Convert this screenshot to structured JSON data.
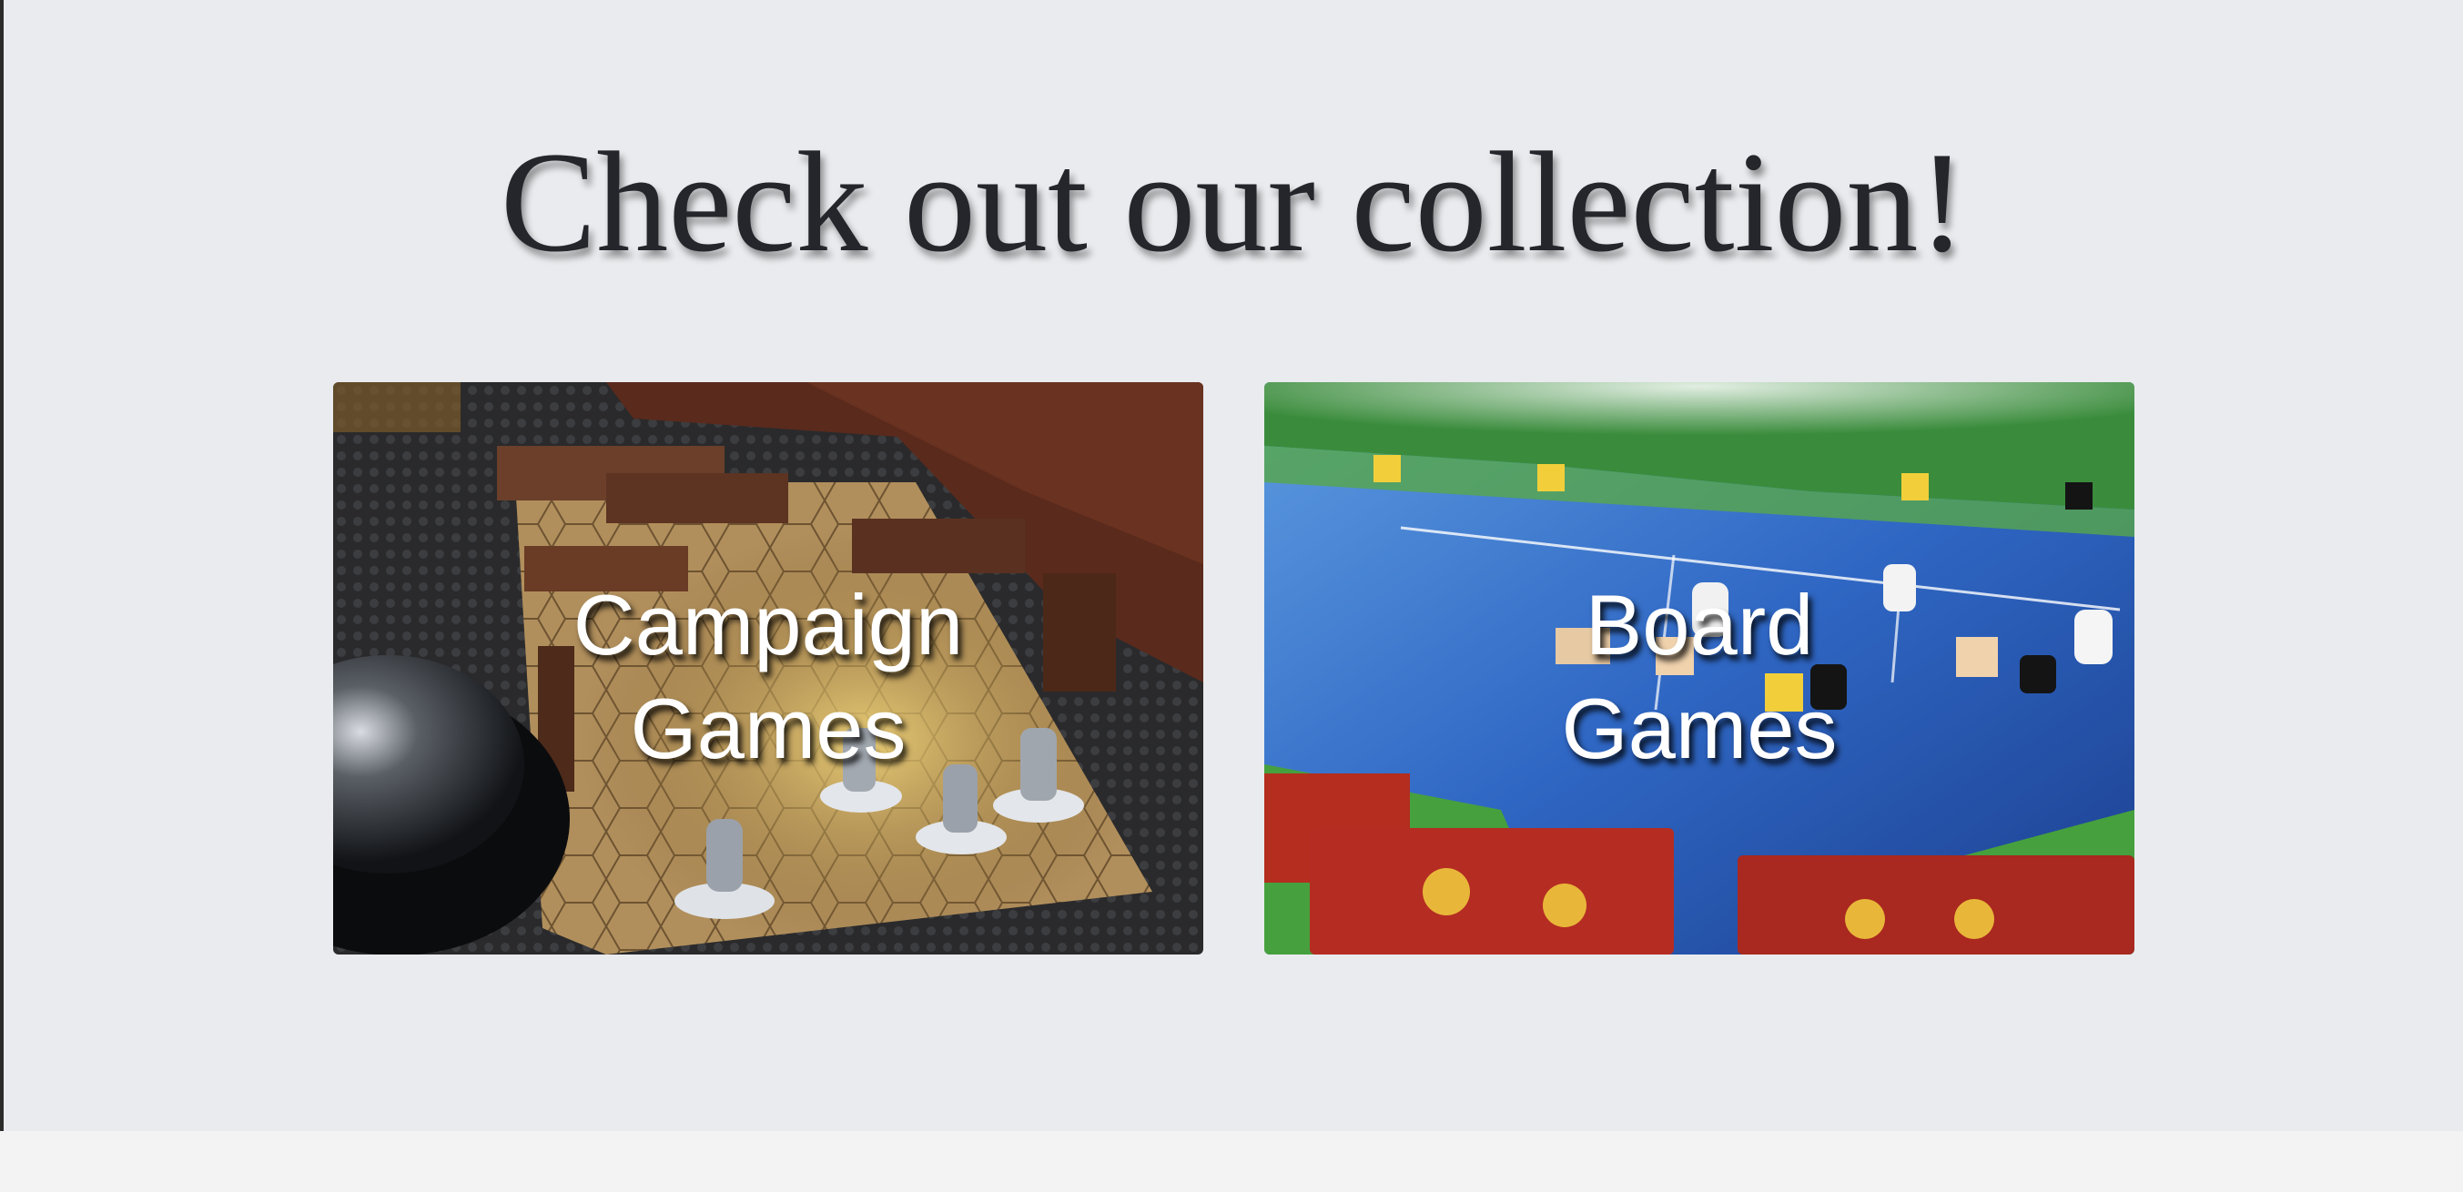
{
  "page": {
    "title": "Check out our collection!"
  },
  "collection": {
    "cards": [
      {
        "line1": "Campaign",
        "line2": "Games",
        "image": "campaign-game-photo"
      },
      {
        "line1": "Board",
        "line2": "Games",
        "image": "board-game-photo"
      }
    ]
  },
  "colors": {
    "section_background": "#e9ebee",
    "page_background": "#f3f3f3",
    "title_text": "#25262b",
    "card_text": "#ffffff"
  }
}
